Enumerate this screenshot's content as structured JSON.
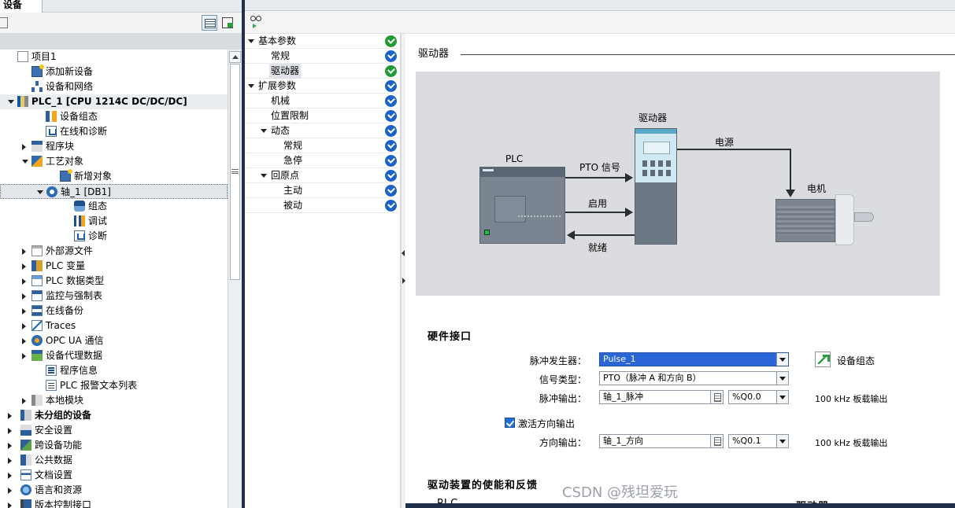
{
  "left_panel": {
    "tab_label": "设备",
    "tree": [
      {
        "label": "项目1",
        "icon": "project-icon",
        "bold": false
      },
      {
        "label": "添加新设备",
        "icon": "add-device-icon",
        "bold": false
      },
      {
        "label": "设备和网络",
        "icon": "network-icon",
        "bold": false
      },
      {
        "label": "PLC_1 [CPU 1214C DC/DC/DC]",
        "icon": "plc-icon",
        "bold": true
      },
      {
        "label": "设备组态",
        "icon": "device-config-icon",
        "bold": false
      },
      {
        "label": "在线和诊断",
        "icon": "diagnostics-icon",
        "bold": false
      },
      {
        "label": "程序块",
        "icon": "program-blocks-icon",
        "bold": false
      },
      {
        "label": "工艺对象",
        "icon": "technology-objects-icon",
        "bold": false
      },
      {
        "label": "新增对象",
        "icon": "add-object-icon",
        "bold": false
      },
      {
        "label": "轴_1 [DB1]",
        "icon": "axis-icon",
        "bold": false
      },
      {
        "label": "组态",
        "icon": "configuration-icon",
        "bold": false
      },
      {
        "label": "调试",
        "icon": "commissioning-icon",
        "bold": false
      },
      {
        "label": "诊断",
        "icon": "diagnostics-icon",
        "bold": false
      },
      {
        "label": "外部源文件",
        "icon": "external-source-icon",
        "bold": false
      },
      {
        "label": "PLC 变量",
        "icon": "plc-tags-icon",
        "bold": false
      },
      {
        "label": "PLC 数据类型",
        "icon": "plc-data-types-icon",
        "bold": false
      },
      {
        "label": "监控与强制表",
        "icon": "watch-table-icon",
        "bold": false
      },
      {
        "label": "在线备份",
        "icon": "online-backup-icon",
        "bold": false
      },
      {
        "label": "Traces",
        "icon": "traces-icon",
        "bold": false
      },
      {
        "label": "OPC UA 通信",
        "icon": "opc-ua-icon",
        "bold": false
      },
      {
        "label": "设备代理数据",
        "icon": "device-proxy-icon",
        "bold": false
      },
      {
        "label": "程序信息",
        "icon": "program-info-icon",
        "bold": false
      },
      {
        "label": "PLC 报警文本列表",
        "icon": "alarm-text-icon",
        "bold": false
      },
      {
        "label": "本地模块",
        "icon": "local-modules-icon",
        "bold": false
      },
      {
        "label": "未分组的设备",
        "icon": "ungrouped-devices-icon",
        "bold": true
      },
      {
        "label": "安全设置",
        "icon": "security-icon",
        "bold": false
      },
      {
        "label": "跨设备功能",
        "icon": "cross-device-icon",
        "bold": false
      },
      {
        "label": "公共数据",
        "icon": "common-data-icon",
        "bold": false
      },
      {
        "label": "文档设置",
        "icon": "document-settings-icon",
        "bold": false
      },
      {
        "label": "语言和资源",
        "icon": "languages-icon",
        "bold": false
      },
      {
        "label": "版本控制接口",
        "icon": "version-control-icon",
        "bold": false
      }
    ]
  },
  "nav": {
    "items": [
      {
        "label": "基本参数",
        "status": "green"
      },
      {
        "label": "常规",
        "status": "blue"
      },
      {
        "label": "驱动器",
        "status": "green"
      },
      {
        "label": "扩展参数",
        "status": "blue"
      },
      {
        "label": "机械",
        "status": "blue"
      },
      {
        "label": "位置限制",
        "status": "blue"
      },
      {
        "label": "动态",
        "status": "blue"
      },
      {
        "label": "常规",
        "status": "blue"
      },
      {
        "label": "急停",
        "status": "blue"
      },
      {
        "label": "回原点",
        "status": "blue"
      },
      {
        "label": "主动",
        "status": "blue"
      },
      {
        "label": "被动",
        "status": "blue"
      }
    ]
  },
  "content": {
    "section_title": "驱动器",
    "diagram": {
      "plc_label": "PLC",
      "drive_label": "驱动器",
      "motor_label": "电机",
      "power_label": "电源",
      "pto_label": "PTO 信号",
      "enable_label": "启用",
      "ready_label": "就绪"
    },
    "hardware_interface": {
      "title": "硬件接口",
      "pulse_generator_label": "脉冲发生器：",
      "pulse_generator_value": "Pulse_1",
      "device_config_link": "设备组态",
      "signal_type_label": "信号类型：",
      "signal_type_value": "PTO（脉冲 A 和方向 B）",
      "pulse_output_label": "脉冲输出：",
      "pulse_output_value": "轴_1_脉冲",
      "pulse_output_address": "%Q0.0",
      "pulse_output_note": "100 kHz 板载输出",
      "activate_direction_label": "激活方向输出",
      "activate_direction_checked": true,
      "direction_output_label": "方向输出：",
      "direction_output_value": "轴_1_方向",
      "direction_output_address": "%Q0.1",
      "direction_output_note": "100 kHz 板载输出"
    },
    "enable_feedback": {
      "title": "驱动装置的使能和反馈",
      "col_plc": "PLC",
      "col_drive": "驱动器"
    }
  },
  "watermark": "CSDN @残坦爱玩"
}
